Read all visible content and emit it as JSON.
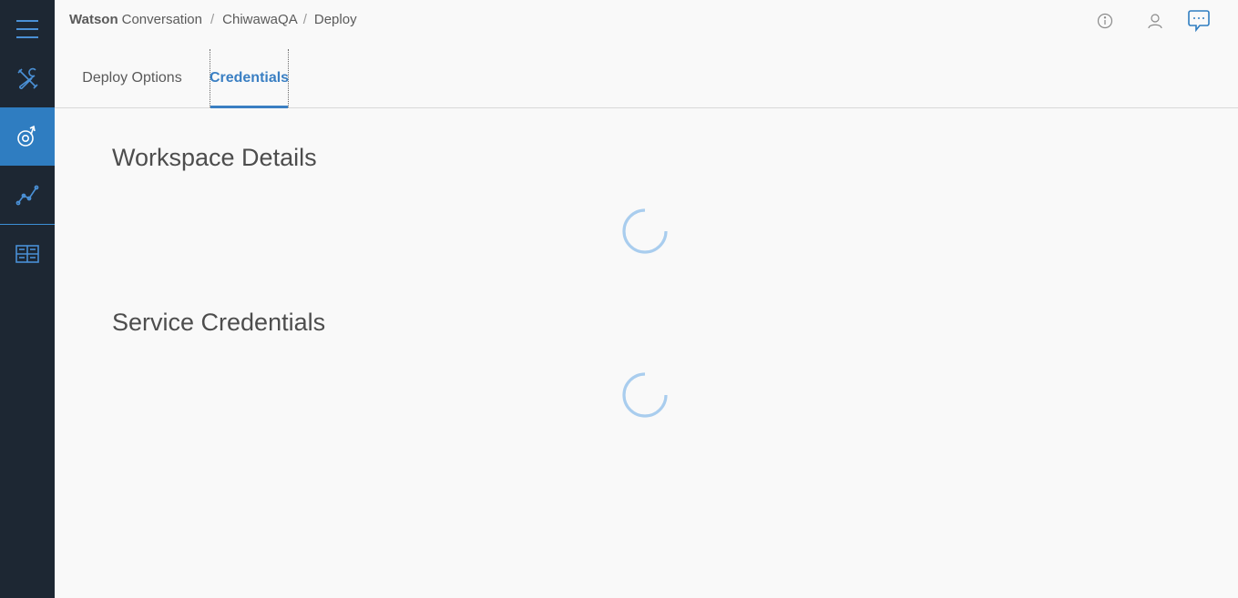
{
  "breadcrumb": {
    "brand_strong": "Watson",
    "brand_light": "Conversation",
    "separator": "/",
    "workspace": "ChiwawaQA",
    "page": "Deploy"
  },
  "tabs": [
    {
      "label": "Deploy Options",
      "active": false
    },
    {
      "label": "Credentials",
      "active": true
    }
  ],
  "sections": {
    "workspace_details": {
      "title": "Workspace Details",
      "loading": true
    },
    "service_credentials": {
      "title": "Service Credentials",
      "loading": true
    }
  },
  "sidebar": {
    "items": [
      {
        "icon": "hamburger-menu-icon",
        "active": false
      },
      {
        "icon": "build-tools-icon",
        "active": false
      },
      {
        "icon": "deploy-icon",
        "active": true
      },
      {
        "icon": "improve-analytics-icon",
        "active": false
      },
      {
        "icon": "dashboard-grid-icon",
        "active": false
      }
    ]
  },
  "header_icons": [
    "info-icon",
    "user-icon",
    "feedback-chat-icon"
  ],
  "colors": {
    "sidebar_bg": "#1d2733",
    "sidebar_active": "#2f7dc1",
    "accent": "#3a7fc3",
    "page_bg": "#f9f9f9",
    "spinner": "#a9cdee"
  }
}
